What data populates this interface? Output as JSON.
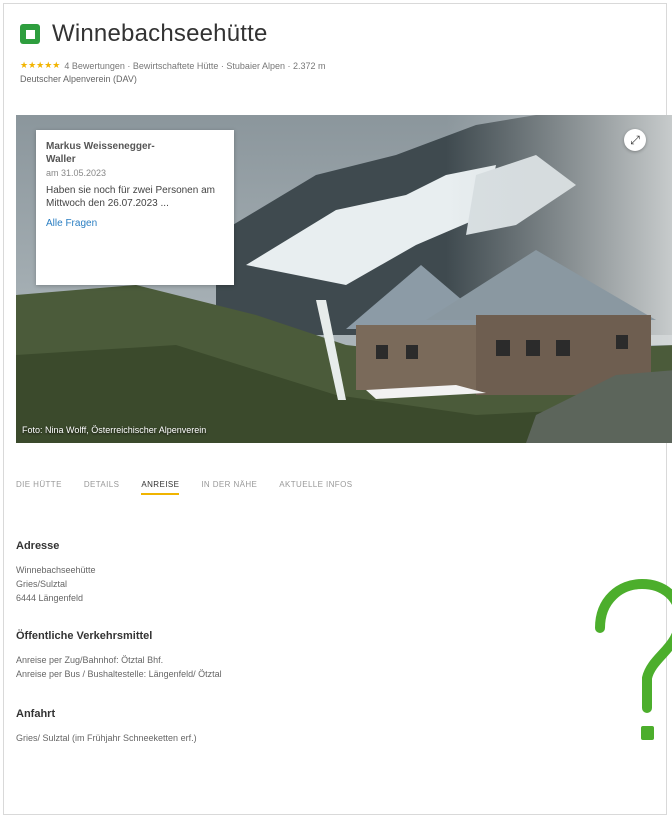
{
  "header": {
    "title": "Winnebachseehütte",
    "stars": "★★★★★",
    "meta": "4 Bewertungen · Bewirtschaftete Hütte · Stubaier Alpen · 2.372 m",
    "club": "Deutscher Alpenverein (DAV)"
  },
  "hero": {
    "caption": "Foto: Nina Wolff, Österreichischer Alpenverein",
    "expand_icon": "expand-icon"
  },
  "qa": {
    "author_line1": "Markus Weissenegger-",
    "author_line2": "Waller",
    "date": "am 31.05.2023",
    "text": "Haben sie noch für zwei Personen am Mittwoch den 26.07.2023 ...",
    "link": "Alle Fragen"
  },
  "tabs": [
    {
      "label": "DIE HÜTTE"
    },
    {
      "label": "DETAILS"
    },
    {
      "label": "ANREISE"
    },
    {
      "label": "IN DER NÄHE"
    },
    {
      "label": "AKTUELLE INFOS"
    }
  ],
  "active_tab": "ANREISE",
  "address": {
    "title": "Adresse",
    "lines": [
      "Winnebachseehütte",
      "Gries/Sulztal",
      "6444 Längenfeld"
    ]
  },
  "transport": {
    "title": "Öffentliche Verkehrsmittel",
    "lines": [
      "Anreise per Zug/Bahnhof: Ötztal Bhf.",
      "Anreise per Bus / Bushaltestelle: Längenfeld/ Ötztal"
    ]
  },
  "approach": {
    "title": "Anfahrt",
    "lines": [
      "Gries/ Sulztal (im Frühjahr Schneeketten erf.)"
    ]
  },
  "colors": {
    "brand_green": "#2e9e3e",
    "star": "#f2b400",
    "active_tab_underline": "#f0b400",
    "link": "#2a7ec2",
    "help_mark": "#4cae2c"
  },
  "icons": {
    "hut": "hut-icon",
    "help": "question-mark-icon"
  }
}
